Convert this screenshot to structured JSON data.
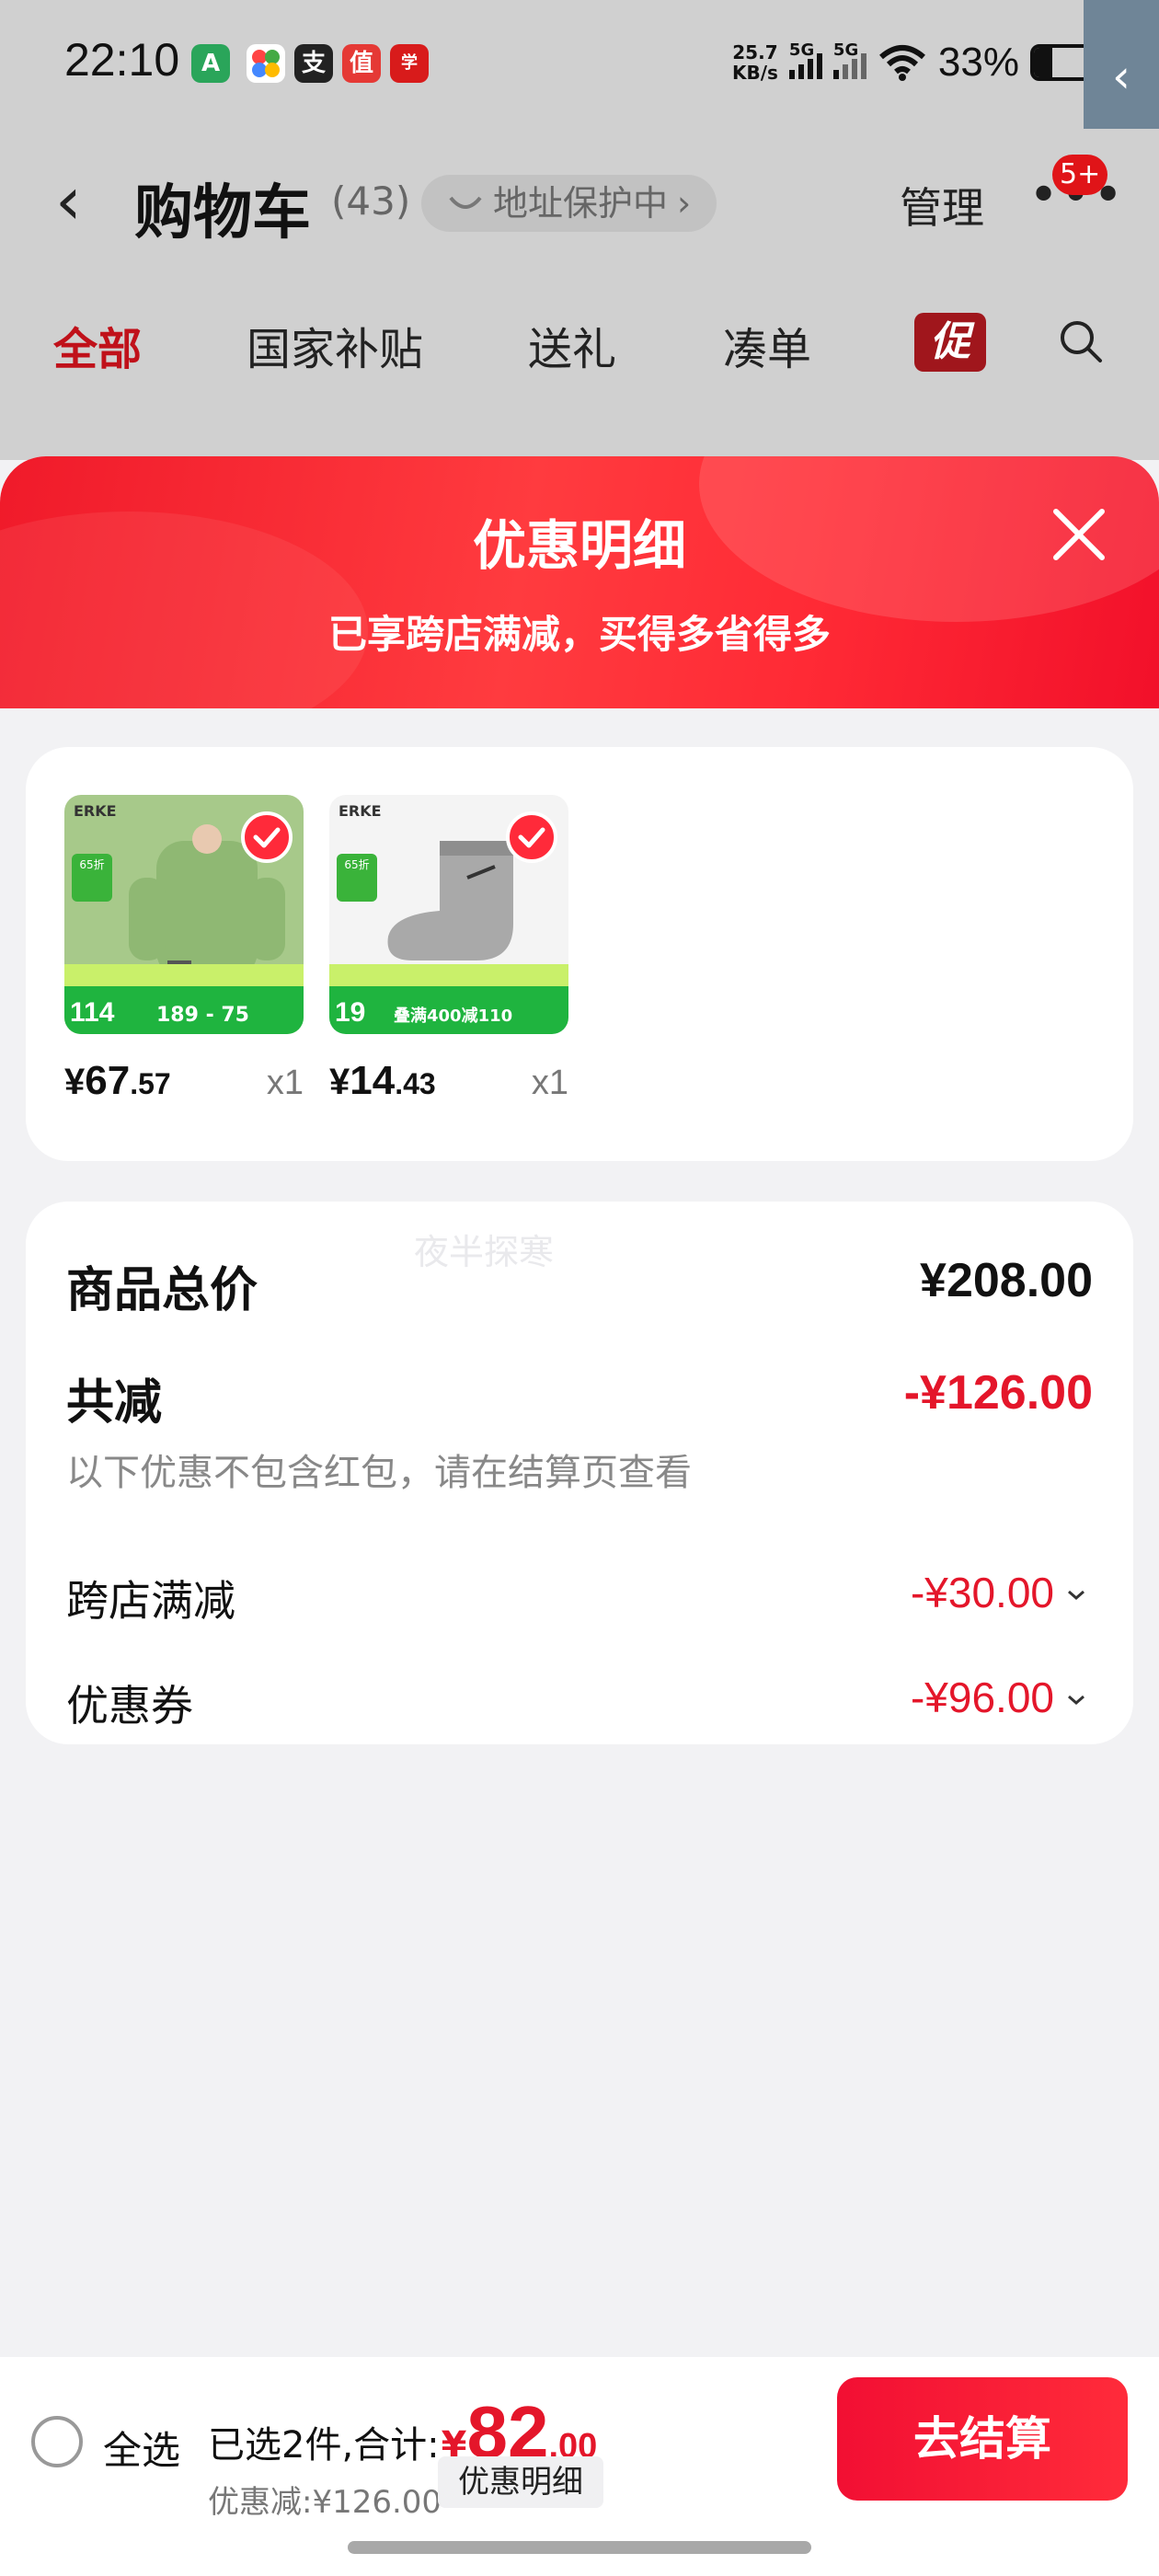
{
  "status_bar": {
    "time": "22:10",
    "app_icons": [
      "huawei-appgallery-icon",
      "pinwheel-app-icon",
      "alipay-icon",
      "value-app-icon",
      "xuexi-app-icon"
    ],
    "net_speed": "25.7",
    "net_speed_unit": "KB/s",
    "sig1": "5G",
    "sig2": "5G",
    "battery_pct": "33%",
    "battery_level": 0.33
  },
  "cart_header": {
    "title": "购物车",
    "count": "(43)",
    "address_protect": "地址保护中",
    "manage": "管理",
    "more_badge": "5+",
    "tabs": [
      "全部",
      "国家补贴",
      "送礼",
      "凑单"
    ],
    "promo_tab": "促"
  },
  "sheet": {
    "title": "优惠明细",
    "subtitle": "已享跨店满减，买得多省得多"
  },
  "products": [
    {
      "brand": "ERKE",
      "currency": "¥",
      "price_int": "67",
      "price_dec": ".57",
      "qty": "x1",
      "thumb_price": "114",
      "thumb_mid": "189 - 75",
      "thumb_color": "#a7c98a"
    },
    {
      "brand": "ERKE",
      "currency": "¥",
      "price_int": "14",
      "price_dec": ".43",
      "qty": "x1",
      "thumb_price": "19",
      "thumb_mid": "叠满400减110",
      "thumb_color": "#f4f4f4"
    }
  ],
  "summary": {
    "watermark": "夜半探寒",
    "total_label": "商品总价",
    "total_value": "¥208.00",
    "reduce_label": "共减",
    "reduce_value": "-¥126.00",
    "reduce_note": "以下优惠不包含红包，请在结算页查看",
    "rows": [
      {
        "label": "跨店满减",
        "value": "-¥30.00"
      },
      {
        "label": "优惠券",
        "value": "-¥96.00"
      }
    ]
  },
  "bottom_bar": {
    "select_all": "全选",
    "selected_prefix": "已选2件,合计:",
    "currency": "¥",
    "total_int": "82",
    "total_dec": ".00",
    "discount_line": "优惠减:¥126.00",
    "detail_chip": "优惠明细",
    "checkout": "去结算"
  },
  "colors": {
    "accent_red": "#e4162a",
    "header_gradient": "#f01a2a"
  }
}
